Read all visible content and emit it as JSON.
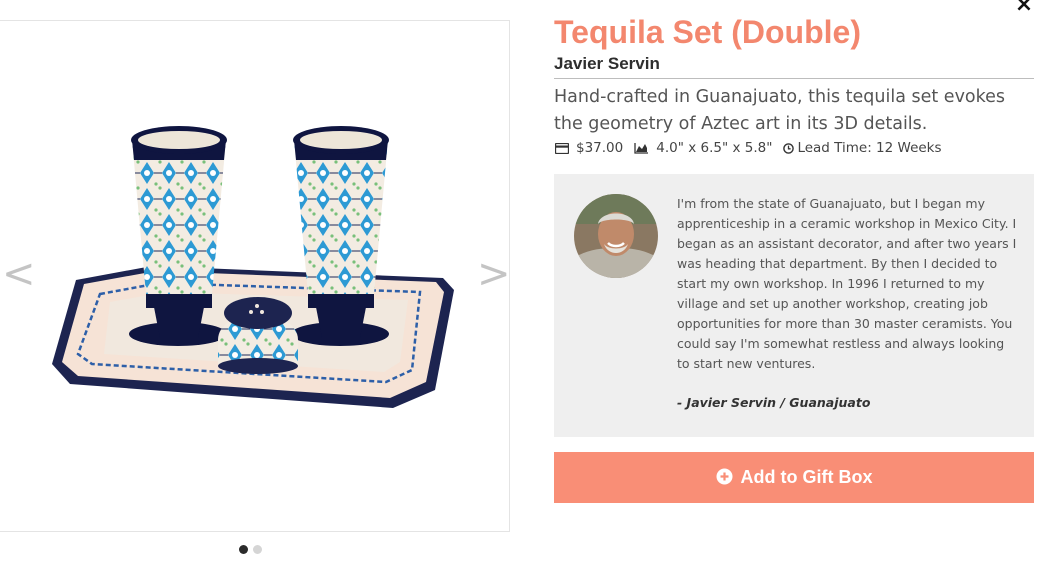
{
  "modal": {
    "close_label": "×",
    "close_icon": "close-icon"
  },
  "gallery": {
    "prev_label": "<",
    "next_label": ">",
    "image_alt": "Tequila set: two ceramic tequila glasses and salt shaker on a rectangular tray",
    "slides_total": 2,
    "active_slide": 1
  },
  "product": {
    "title": "Tequila Set (Double)",
    "artist": "Javier Servin",
    "description": "Hand-crafted in Guanajuato, this tequila set evokes the geometry of Aztec art in its 3D details.",
    "price": "$37.00",
    "dimensions": "4.0\" x 6.5\" x 5.8\"",
    "lead_time": "Lead Time: 12 Weeks",
    "icons": {
      "price": "credit-card-icon",
      "dimensions": "area-chart-icon",
      "lead_time": "clock-icon"
    }
  },
  "bio": {
    "text": "I'm from the state of Guanajuato, but I began my apprenticeship in a ceramic workshop in Mexico City. I began as an assistant decorator, and after two years I was heading that department. By then I decided to start my own workshop. In 1996 I returned to my village and set up another workshop, creating job opportunities for more than 30 master ceramists. You could say I'm somewhat restless and always looking to start new ventures.",
    "signature": "- Javier Servin / Guanajuato"
  },
  "cta": {
    "label": "Add to Gift Box",
    "icon": "plus-circle-icon"
  },
  "colors": {
    "accent": "#f3876e",
    "button": "#f98e76",
    "bio_bg": "#efefef"
  }
}
